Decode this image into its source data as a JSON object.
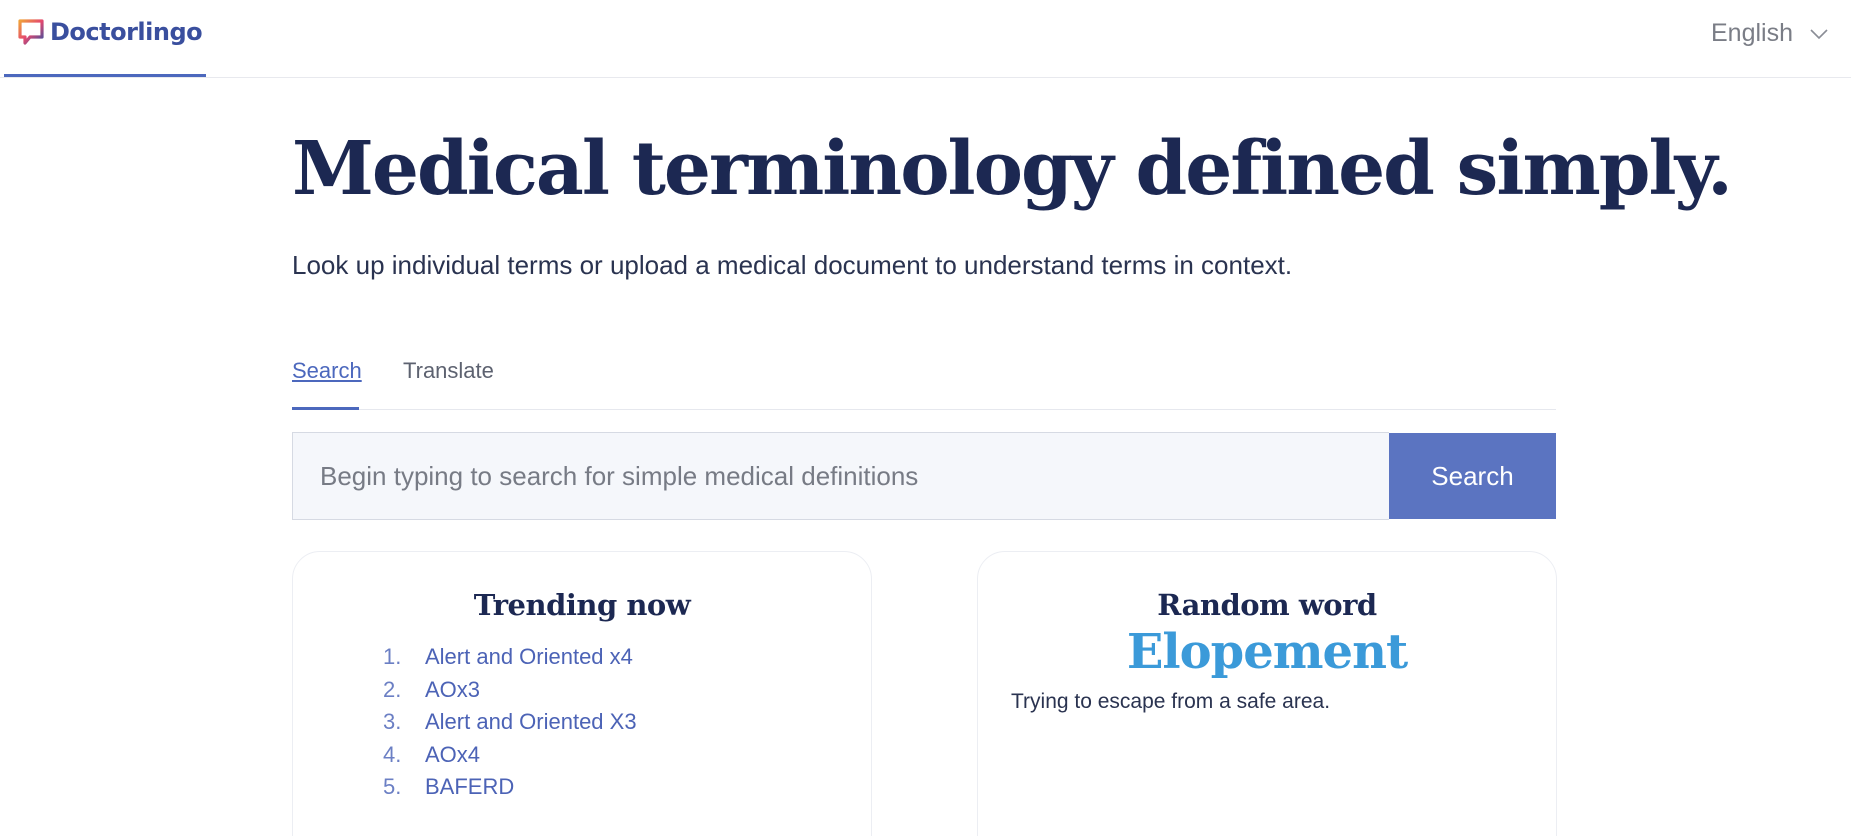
{
  "header": {
    "brand": "Doctorlingo",
    "language": "English"
  },
  "hero": {
    "title": "Medical terminology defined simply.",
    "subtitle": "Look up individual terms or upload a medical document to understand terms in context."
  },
  "tabs": [
    {
      "label": "Search",
      "active": true
    },
    {
      "label": "Translate",
      "active": false
    }
  ],
  "search": {
    "placeholder": "Begin typing to search for simple medical definitions",
    "value": "",
    "button_label": "Search"
  },
  "trending": {
    "title": "Trending now",
    "items": [
      {
        "num": "1.",
        "label": "Alert and Oriented x4"
      },
      {
        "num": "2.",
        "label": "AOx3"
      },
      {
        "num": "3.",
        "label": "Alert and Oriented X3"
      },
      {
        "num": "4.",
        "label": "AOx4"
      },
      {
        "num": "5.",
        "label": "BAFERD"
      }
    ]
  },
  "random": {
    "title": "Random word",
    "word": "Elopement",
    "definition": "Trying to escape from a safe area."
  },
  "colors": {
    "brand": "#3a4f9e",
    "accent": "#5b74c1",
    "heading": "#1c2852",
    "random_word": "#3b9ad9"
  }
}
